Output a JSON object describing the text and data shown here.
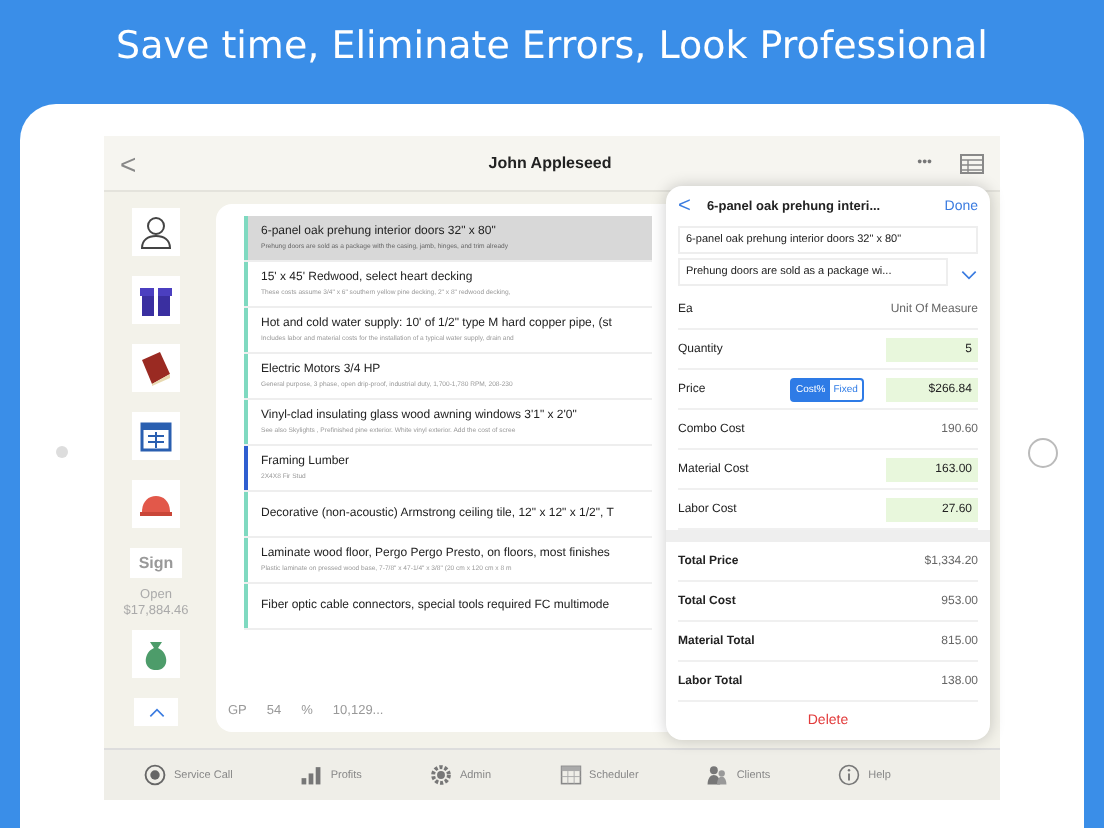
{
  "headline": "Save time, Eliminate Errors, Look Professional",
  "nav": {
    "back": "<",
    "title": "John Appleseed",
    "more": "•••"
  },
  "sidebar": {
    "sign": "Sign",
    "status": "Open",
    "amount": "$17,884.46"
  },
  "list": {
    "items": [
      {
        "title": "6-panel oak prehung interior doors 32\" x 80\"",
        "description": "Prehung doors are sold as a package with the casing, jamb, hinges, and trim already",
        "selected": true,
        "color": "#7fd9c0"
      },
      {
        "title": "15' x 45' Redwood, select heart decking",
        "description": "These costs assume 3/4\" x 6\" southern yellow pine decking, 2\" x 8\" redwood decking,",
        "selected": false,
        "color": "#7fd9c0"
      },
      {
        "title": "Hot and cold water supply: 10' of 1/2\" type M hard copper pipe, (st",
        "description": "Includes labor and material costs for the installation of a typical water supply, drain and",
        "selected": false,
        "color": "#7fd9c0"
      },
      {
        "title": "Electric Motors 3/4  HP",
        "description": "General purpose, 3 phase, open drip-proof, industrial duty, 1,700-1,780 RPM, 208-230",
        "selected": false,
        "color": "#7fd9c0"
      },
      {
        "title": "Vinyl-clad insulating glass wood awning windows 3'1\" x 2'0\"",
        "description": "See also Skylights , Prefinished pine exterior. White vinyl exterior. Add the cost of scree",
        "selected": false,
        "color": "#7fd9c0"
      },
      {
        "title": "Framing Lumber",
        "description": "2X4X8 Fir Stud",
        "selected": false,
        "color": "#2f5fd0"
      },
      {
        "title": "Decorative (non-acoustic) Armstrong ceiling tile, 12\" x 12\" x 1/2\", T",
        "selected": false,
        "color": "#7fd9c0"
      },
      {
        "title": "Laminate wood floor, Pergo Pergo Presto, on floors, most finishes",
        "description": "Plastic laminate on pressed wood base, 7-7/8\" x 47-1/4\" x 3/8\" (20 cm x 120 cm x 8 m",
        "selected": false,
        "color": "#7fd9c0"
      },
      {
        "title": "Fiber optic cable connectors, special tools required FC multimode",
        "selected": false,
        "color": "#7fd9c0"
      }
    ]
  },
  "footer": [
    "GP",
    "54",
    "%",
    "10,129..."
  ],
  "tabs": [
    {
      "label": "Service Call"
    },
    {
      "label": "Profits"
    },
    {
      "label": "Admin"
    },
    {
      "label": "Scheduler"
    },
    {
      "label": "Clients"
    },
    {
      "label": "Help"
    }
  ],
  "popup": {
    "back": "<",
    "title": "6-panel oak prehung interi...",
    "done": "Done",
    "name": "6-panel oak prehung interior doors 32\" x 80\"",
    "description": "Prehung doors are sold as a package wi...",
    "rows": [
      {
        "kind": "plain",
        "label": "Ea",
        "value": "Unit Of Measure"
      },
      {
        "kind": "input",
        "label": "Quantity",
        "value": "5"
      },
      {
        "kind": "price",
        "label": "Price",
        "value": "$266.84",
        "options": [
          {
            "label": "Cost%",
            "selected": true
          },
          {
            "label": "Fixed",
            "selected": false
          }
        ]
      },
      {
        "kind": "plain",
        "label": "Combo Cost",
        "value": "190.60"
      },
      {
        "kind": "input",
        "label": "Material Cost",
        "value": "163.00"
      },
      {
        "kind": "input",
        "label": "Labor Cost",
        "value": "27.60"
      }
    ],
    "totals": [
      {
        "label": "Total Price",
        "value": "$1,334.20"
      },
      {
        "label": "Total Cost",
        "value": "953.00"
      },
      {
        "label": "Material Total",
        "value": "815.00"
      },
      {
        "label": "Labor Total",
        "value": "138.00"
      }
    ],
    "delete": "Delete"
  }
}
